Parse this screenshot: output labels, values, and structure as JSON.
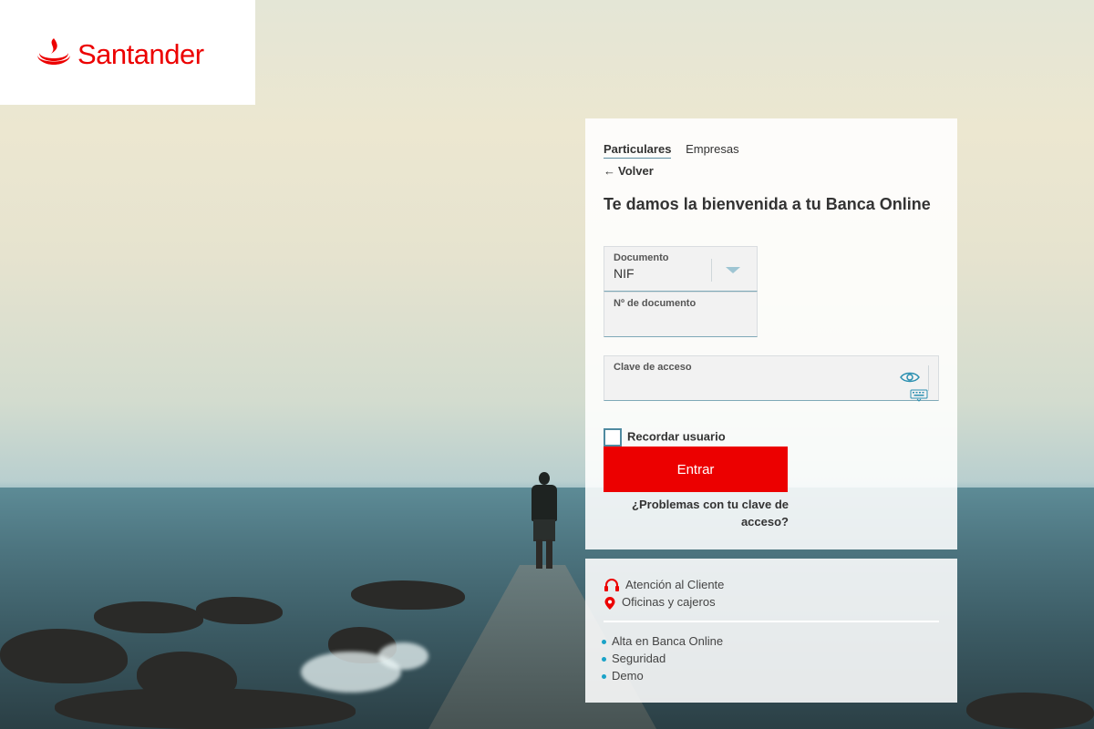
{
  "brand": {
    "name": "Santander",
    "color": "#ec0000",
    "logo_icon": "santander-flame-icon"
  },
  "tabs": [
    {
      "label": "Particulares",
      "active": true
    },
    {
      "label": "Empresas",
      "active": false
    }
  ],
  "back": {
    "label": "Volver",
    "icon": "arrow-left-icon"
  },
  "title": "Te damos la bienvenida a tu Banca Online",
  "form": {
    "document_type": {
      "label": "Documento",
      "value": "NIF",
      "icon": "chevron-down-icon"
    },
    "document_number": {
      "label": "Nº de documento",
      "value": ""
    },
    "password": {
      "label": "Clave de acceso",
      "value": "",
      "icons": [
        "eye-icon",
        "keyboard-icon"
      ]
    },
    "remember": {
      "label": "Recordar usuario",
      "checked": false
    },
    "submit_label": "Entrar",
    "problems_label": "¿Problemas con tu clave de acceso?"
  },
  "help": [
    {
      "label": "Atención al Cliente",
      "icon": "headset-icon"
    },
    {
      "label": "Oficinas y cajeros",
      "icon": "map-pin-icon"
    }
  ],
  "links": [
    {
      "label": "Alta en Banca Online"
    },
    {
      "label": "Seguridad"
    },
    {
      "label": "Demo"
    }
  ],
  "colors": {
    "accent": "#ec0000",
    "link_bullet": "#1ba3c8",
    "field_underline": "#7fa9b8"
  }
}
